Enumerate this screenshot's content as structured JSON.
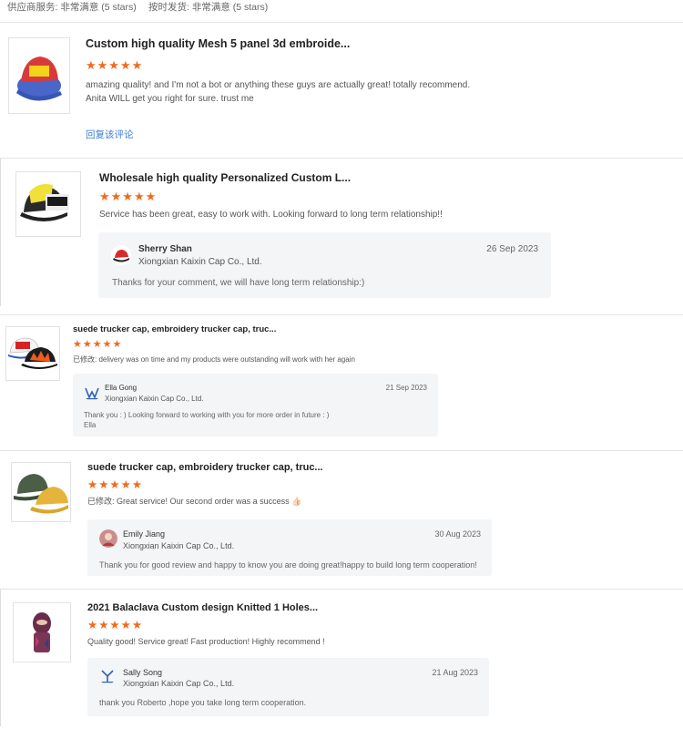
{
  "ratings": {
    "service_label": "供应商服务:",
    "service_value": "非常满意",
    "service_stars": "(5 stars)",
    "delivery_label": "按时发货:",
    "delivery_value": "非常满意",
    "delivery_stars": "(5 stars)"
  },
  "stars_glyph": "★★★★★",
  "reviews": [
    {
      "product_title": "Custom high quality Mesh 5 panel 3d embroide...",
      "rating": 5,
      "comment": "amazing quality! and I'm not a bot or anything these guys are actually great! totally recommend. Anita WILL get you right for sure. trust me",
      "reply_link": "回复该评论"
    },
    {
      "product_title": "Wholesale high quality Personalized Custom L...",
      "rating": 5,
      "comment": "Service has been great, easy to work with.  Looking forward to long term relationship!!",
      "reply": {
        "name": "Sherry Shan",
        "company": "Xiongxian Kaixin Cap Co., Ltd.",
        "date": "26 Sep 2023",
        "text": "Thanks for your comment, we will have long term relationship:)"
      }
    },
    {
      "product_title": "suede trucker cap, embroidery trucker cap, truc...",
      "rating": 5,
      "comment_prefix": "已修改:",
      "comment": "delivery was on time and my products were outstanding will work with her again",
      "reply": {
        "name": "Ella Gong",
        "company": "Xiongxian Kaixin Cap Co., Ltd.",
        "date": "21 Sep 2023",
        "text": "Thank you : )    Looking forward to working with you for more order in future : )",
        "text2": "Ella"
      }
    },
    {
      "product_title": "suede trucker cap, embroidery trucker cap, truc...",
      "rating": 5,
      "comment_prefix": "已修改:",
      "comment": "Great service! Our second order was a success 👍🏻",
      "reply": {
        "name": "Emily Jiang",
        "company": "Xiongxian Kaixin Cap Co., Ltd.",
        "date": "30 Aug 2023",
        "text": "Thank you for good review and happy to know you are doing great!happy to build long term cooperation!"
      }
    },
    {
      "product_title": "2021 Balaclava Custom design Knitted 1 Holes...",
      "rating": 5,
      "comment": "Quality good! Service great! Fast production! Highly recommend !",
      "reply": {
        "name": "Sally Song",
        "company": "Xiongxian Kaixin Cap Co., Ltd.",
        "date": "21 Aug 2023",
        "text": "thank you Roberto ,hope you take long term cooperation."
      }
    }
  ]
}
